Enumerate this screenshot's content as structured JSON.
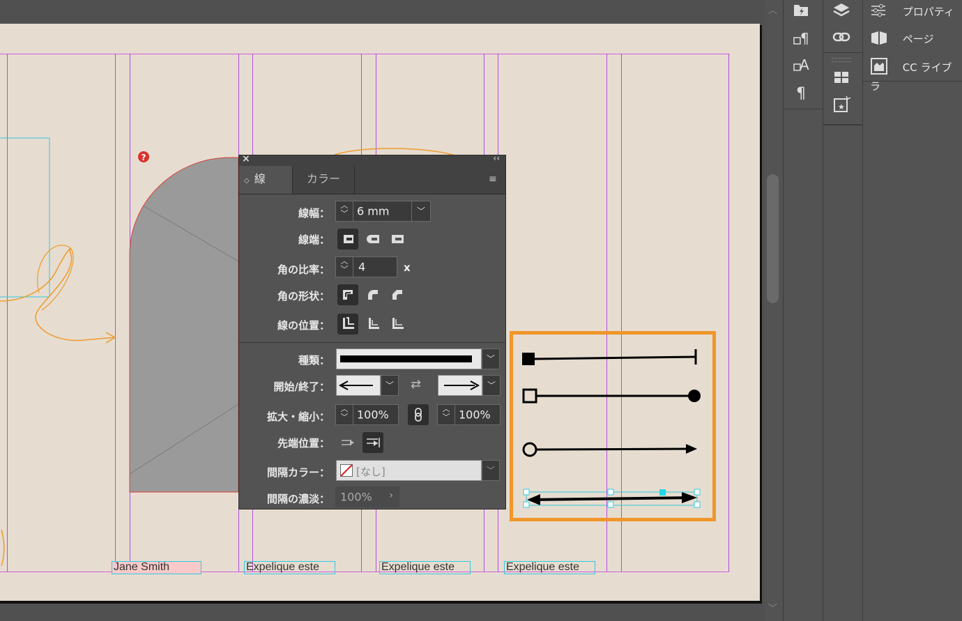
{
  "document": {
    "text_frames": [
      "Jane Smith",
      "Expelique este",
      "Expelique este",
      "Expelique este"
    ]
  },
  "right_panels": {
    "items": [
      {
        "label": "プロパティ",
        "icon": "properties-icon"
      },
      {
        "label": "ページ",
        "icon": "pages-icon"
      },
      {
        "label": "CC ライブラ",
        "icon": "cc-libraries-icon"
      }
    ]
  },
  "stroke_panel": {
    "tabs": [
      "線",
      "カラー"
    ],
    "weight_label": "線幅：",
    "weight_value": "6 mm",
    "cap_label": "線端：",
    "miter_label": "角の比率：",
    "miter_value": "4",
    "miter_unit": "x",
    "join_label": "角の形状：",
    "align_label": "線の位置：",
    "type_label": "種類：",
    "start_end_label": "開始/終了：",
    "scale_label": "拡大・縮小：",
    "scale_start": "100%",
    "scale_end": "100%",
    "arrow_align_label": "先端位置：",
    "gap_color_label": "間隔カラー：",
    "gap_color_value": "[なし]",
    "gap_tint_label": "間隔の濃淡：",
    "gap_tint_value": "100%"
  },
  "colors": {
    "accent_orange": "#f0962a",
    "guide_purple": "#b44ce0",
    "frame_cyan": "#33c8e0",
    "panel_bg": "#535353"
  }
}
